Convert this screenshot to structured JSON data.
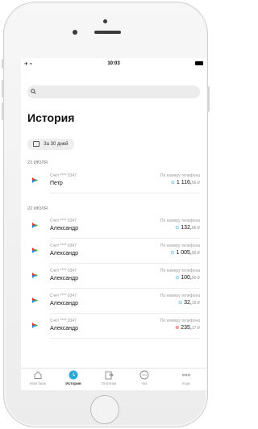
{
  "statusbar": {
    "left_icons": "✈ ≈",
    "time": "10:03"
  },
  "search": {
    "icon": "search-icon"
  },
  "page_title": "История",
  "period_filter": {
    "label": "За 30 дней",
    "icon": "calendar-icon"
  },
  "sections": [
    {
      "date": "23 ИЮЛЯ",
      "transactions": [
        {
          "account": "Счёт **** 0347",
          "name": "Петр",
          "kind": "По номеру телефона",
          "status_icon": "check-circle-icon",
          "amount_main": "1 116,",
          "amount_cents": "56 ₽",
          "status": "ok"
        }
      ]
    },
    {
      "date": "22 ИЮЛЯ",
      "transactions": [
        {
          "account": "Счёт **** 0347",
          "name": "Александр",
          "kind": "По номеру телефона",
          "status_icon": "check-circle-icon",
          "amount_main": "132,",
          "amount_cents": "66 ₽",
          "status": "ok"
        },
        {
          "account": "Счёт **** 0347",
          "name": "Александр",
          "kind": "По номеру телефона",
          "status_icon": "check-circle-icon",
          "amount_main": "1 005,",
          "amount_cents": "00 ₽",
          "status": "ok"
        },
        {
          "account": "Счёт **** 0347",
          "name": "Александр",
          "kind": "По номеру телефона",
          "status_icon": "check-circle-icon",
          "amount_main": "100,",
          "amount_cents": "50 ₽",
          "status": "ok"
        },
        {
          "account": "Счёт **** 0347",
          "name": "Александр",
          "kind": "По номеру телефона",
          "status_icon": "check-circle-icon",
          "amount_main": "32,",
          "amount_cents": "16 ₽",
          "status": "ok"
        },
        {
          "account": "Счёт **** 0347",
          "name": "Александр",
          "kind": "По номеру телефона",
          "status_icon": "error-circle-icon",
          "amount_main": "235,",
          "amount_cents": "17 ₽",
          "status": "error"
        }
      ]
    }
  ],
  "tabbar": {
    "items": [
      {
        "label": "Мой банк",
        "icon": "home-icon"
      },
      {
        "label": "История",
        "icon": "clock-icon",
        "active": true
      },
      {
        "label": "Платежи",
        "icon": "transfer-icon"
      },
      {
        "label": "Чат",
        "icon": "chat-icon"
      },
      {
        "label": "Ещё",
        "icon": "more-dots-icon"
      }
    ]
  },
  "colors": {
    "accent": "#2aa7d9",
    "error": "#e5484d",
    "logo_red": "#e5312d",
    "logo_blue": "#1e88e5",
    "logo_green": "#3fae49"
  }
}
